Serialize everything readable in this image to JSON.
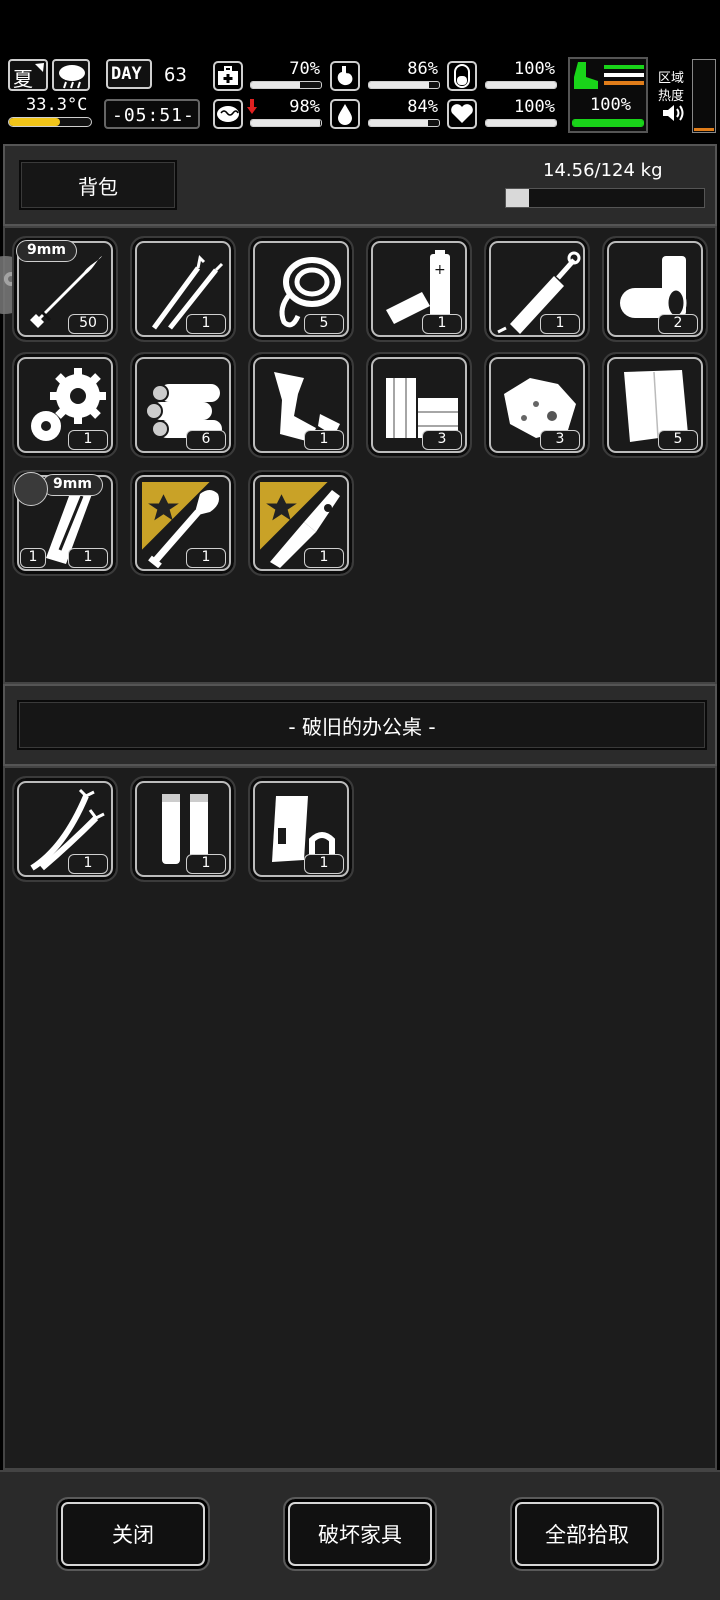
{
  "hud": {
    "season": "夏",
    "temperature": "33.3°C",
    "day_label": "DAY",
    "day_number": "63",
    "clock": "-05:51-",
    "stats": [
      {
        "name": "health",
        "icon": "medkit-icon",
        "value": "70%",
        "level": 0.7
      },
      {
        "name": "hunger",
        "icon": "stomach-icon",
        "value": "86%",
        "level": 0.86
      },
      {
        "name": "energy",
        "icon": "pill-icon",
        "value": "100%",
        "level": 1.0
      },
      {
        "name": "sanity",
        "icon": "brain-icon",
        "value": "98%",
        "level": 0.98
      },
      {
        "name": "thirst",
        "icon": "water-drop-icon",
        "value": "84%",
        "level": 0.84
      },
      {
        "name": "heart",
        "icon": "heart-icon",
        "value": "100%",
        "level": 1.0
      }
    ],
    "stamina": {
      "value": "100%",
      "level": 1.0
    },
    "zone_heat_label_1": "区域",
    "zone_heat_label_2": "热度",
    "colors": {
      "accent_green": "#19d419",
      "accent_orange": "#e07d1a",
      "temp_bar": "#f0c419"
    }
  },
  "backpack": {
    "title": "背包",
    "weight": "14.56/124 kg",
    "weight_level": 0.117,
    "items": [
      {
        "icon": "bullet-icon",
        "count": "50",
        "caliber": "9mm"
      },
      {
        "icon": "lockpick-icon",
        "count": "1"
      },
      {
        "icon": "rope-icon",
        "count": "5"
      },
      {
        "icon": "battery-icon",
        "count": "1"
      },
      {
        "icon": "syringe-icon",
        "count": "1"
      },
      {
        "icon": "tape-roll-icon",
        "count": "2"
      },
      {
        "icon": "gears-icon",
        "count": "1"
      },
      {
        "icon": "logs-icon",
        "count": "6"
      },
      {
        "icon": "scrap-metal-icon",
        "count": "1"
      },
      {
        "icon": "planks-icon",
        "count": "3"
      },
      {
        "icon": "ore-icon",
        "count": "3"
      },
      {
        "icon": "cloth-icon",
        "count": "5"
      },
      {
        "icon": "magazine-icon",
        "count": "1",
        "left_count": "1",
        "caliber": "9mm"
      },
      {
        "icon": "shovel-icon",
        "count": "1",
        "starred": true
      },
      {
        "icon": "knife-icon",
        "count": "1",
        "starred": true
      }
    ]
  },
  "container": {
    "title": "- 破旧的办公桌 -",
    "items": [
      {
        "icon": "wire-icon",
        "count": "1"
      },
      {
        "icon": "pipes-icon",
        "count": "1"
      },
      {
        "icon": "metal-parts-icon",
        "count": "1"
      }
    ]
  },
  "buttons": {
    "close": "关闭",
    "destroy": "破坏家具",
    "take_all": "全部拾取"
  }
}
